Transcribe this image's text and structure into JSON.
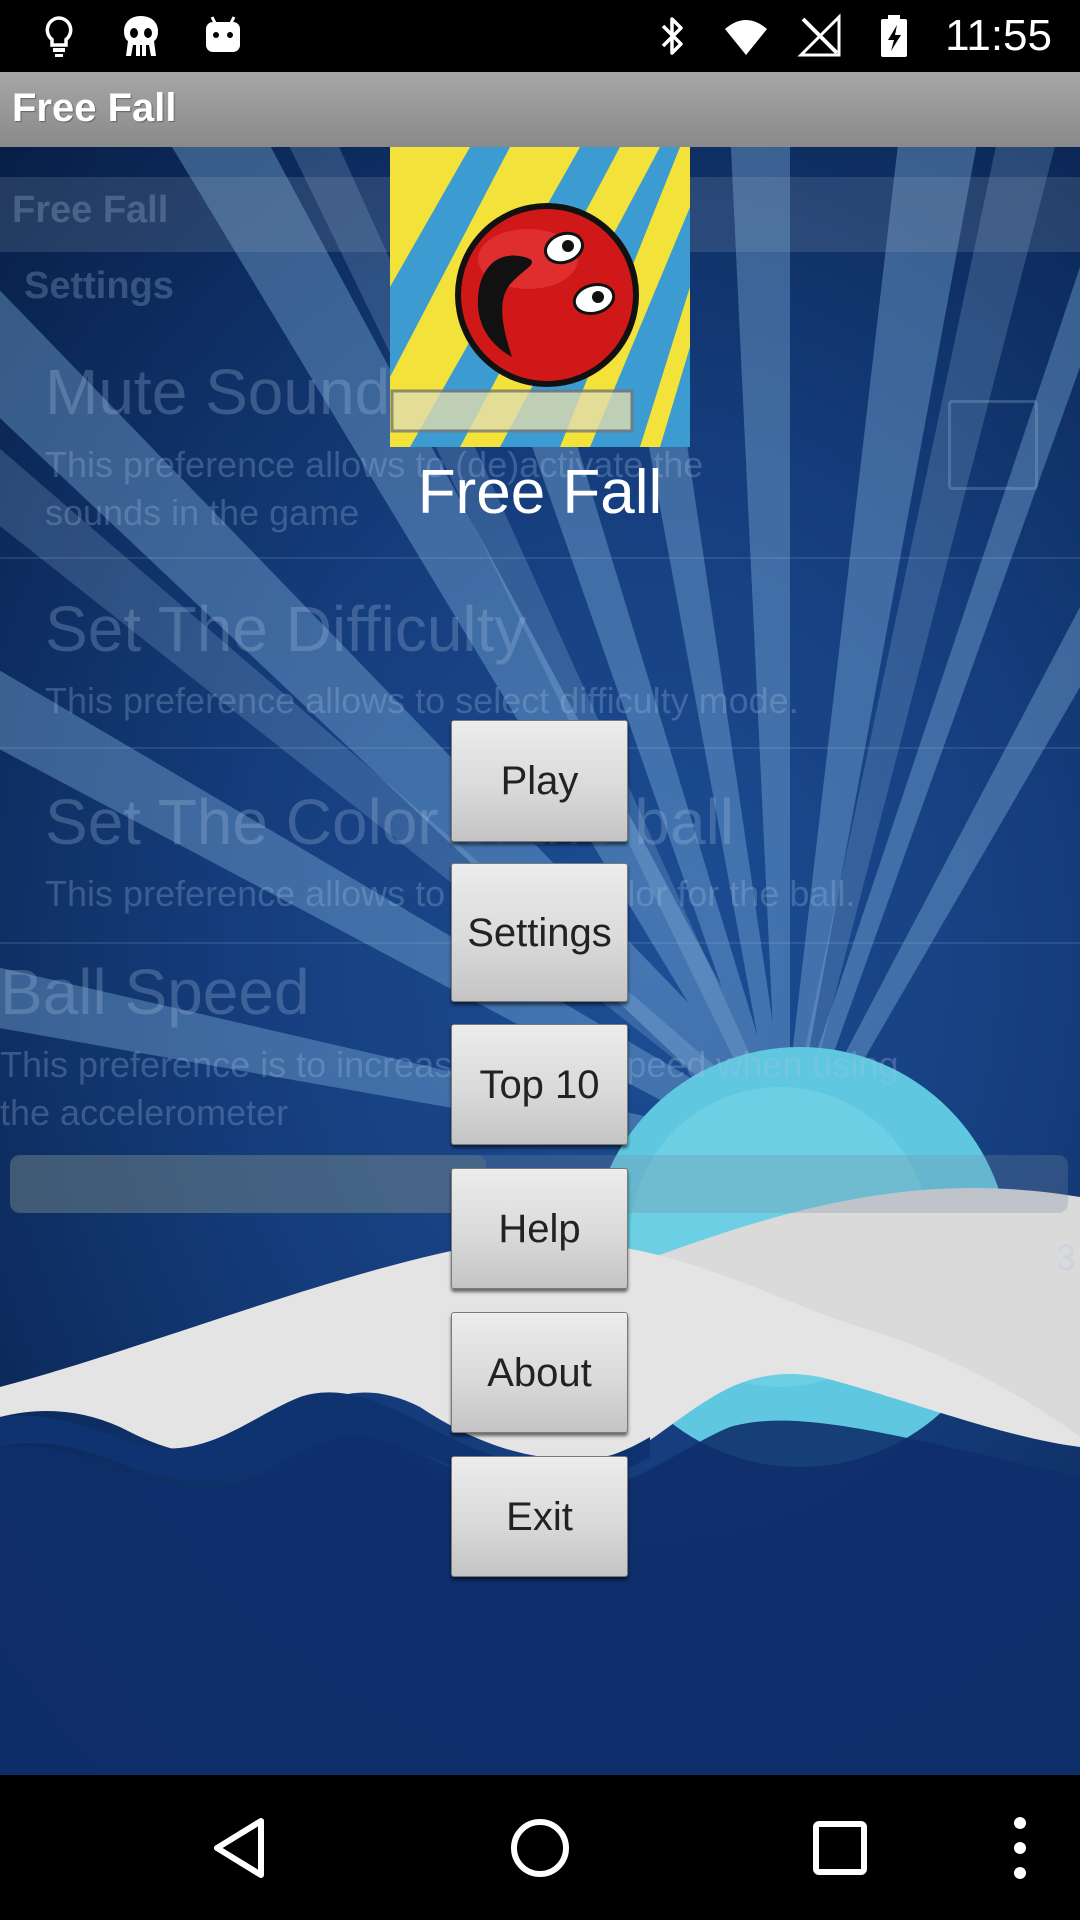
{
  "status_bar": {
    "time": "11:55",
    "left_icons": [
      "lightbulb-icon",
      "alien-icon",
      "android-icon"
    ],
    "right_icons": [
      "bluetooth-icon",
      "wifi-icon",
      "no-signal-icon",
      "battery-icon"
    ]
  },
  "title_bar": {
    "title": "Free Fall"
  },
  "background_ghost": {
    "header_title": "Free Fall",
    "category": "Settings",
    "items": [
      {
        "title": "Mute Sound",
        "summary_line1": "This preference allows to (de)activate the",
        "summary_line2": "sounds in the game"
      },
      {
        "title": "Set The Difficulty",
        "summary_line1": "This preference allows to select difficulty mode.",
        "summary_line2": ""
      },
      {
        "title": "Set The Color of the ball",
        "summary_line1": "This preference allows to select a color for the ball.",
        "summary_line2": ""
      },
      {
        "title": "Ball Speed",
        "summary_line1": "This preference is to increase the ball speed when using",
        "summary_line2": "the accelerometer"
      }
    ],
    "seek_value": "3"
  },
  "header": {
    "app_name": "Free Fall"
  },
  "menu": {
    "play": "Play",
    "settings": "Settings",
    "top10": "Top 10",
    "help": "Help",
    "about": "About",
    "exit": "Exit"
  },
  "nav_bar": {
    "icons": [
      "back-icon",
      "home-icon",
      "recents-icon",
      "overflow-menu-icon"
    ]
  },
  "colors": {
    "background": "#153d7c",
    "title_bar": "#9a9a9a",
    "button": "#dadada",
    "ball": "#d01818",
    "logo_yellow": "#f2e23a",
    "logo_blue": "#3c9bd0"
  }
}
